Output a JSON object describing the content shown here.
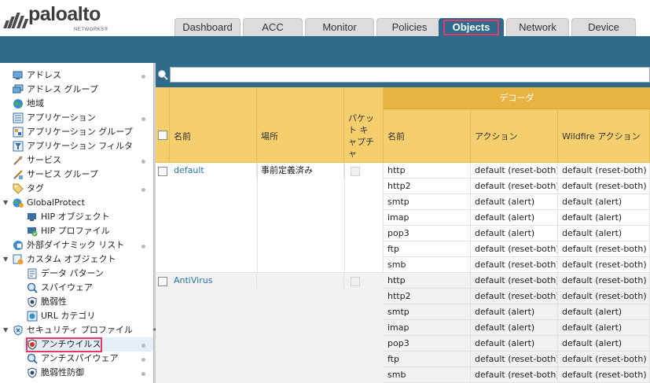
{
  "brand": {
    "name": "paloalto",
    "sub": "NETWORKS®"
  },
  "tabs": [
    {
      "label": "Dashboard"
    },
    {
      "label": "ACC"
    },
    {
      "label": "Monitor"
    },
    {
      "label": "Policies"
    },
    {
      "label": "Objects",
      "active": true
    },
    {
      "label": "Network"
    },
    {
      "label": "Device"
    }
  ],
  "sidebar": {
    "items": [
      {
        "label": "アドレス",
        "icon": "address-icon"
      },
      {
        "label": "アドレス グループ",
        "icon": "address-group-icon"
      },
      {
        "label": "地域",
        "icon": "globe-icon"
      },
      {
        "label": "アプリケーション",
        "icon": "application-icon"
      },
      {
        "label": "アプリケーション グループ",
        "icon": "application-group-icon"
      },
      {
        "label": "アプリケーション フィルタ",
        "icon": "application-filter-icon"
      },
      {
        "label": "サービス",
        "icon": "service-icon"
      },
      {
        "label": "サービス グループ",
        "icon": "service-group-icon"
      },
      {
        "label": "タグ",
        "icon": "tag-icon"
      },
      {
        "label": "GlobalProtect",
        "icon": "globalprotect-icon"
      },
      {
        "label": "HIP オブジェクト",
        "icon": "hip-object-icon"
      },
      {
        "label": "HIP プロファイル",
        "icon": "hip-profile-icon"
      },
      {
        "label": "外部ダイナミック リスト",
        "icon": "external-list-icon"
      },
      {
        "label": "カスタム オブジェクト",
        "icon": "custom-object-icon"
      },
      {
        "label": "データ パターン",
        "icon": "data-pattern-icon"
      },
      {
        "label": "スパイウェア",
        "icon": "spyware-icon"
      },
      {
        "label": "脆弱性",
        "icon": "vulnerability-icon"
      },
      {
        "label": "URL カテゴリ",
        "icon": "url-category-icon"
      },
      {
        "label": "セキュリティ プロファイル",
        "icon": "security-profile-icon"
      },
      {
        "label": "アンチウイルス",
        "icon": "antivirus-icon"
      },
      {
        "label": "アンチスパイウェア",
        "icon": "anti-spyware-icon"
      },
      {
        "label": "脆弱性防御",
        "icon": "vulnerability-protection-icon"
      }
    ]
  },
  "search": {
    "value": "",
    "placeholder": ""
  },
  "table": {
    "headers": {
      "name": "名前",
      "location": "場所",
      "pcap": "パケット キャプチャ",
      "group": "デコーダ",
      "decoder_name": "名前",
      "action": "アクション",
      "wildfire": "Wildfire アクション"
    },
    "profiles": [
      {
        "name": "default",
        "location": "事前定義済み",
        "rows": [
          {
            "decoder": "http",
            "action": "default (reset-both)",
            "wildfire": "default (reset-both)"
          },
          {
            "decoder": "http2",
            "action": "default (reset-both)",
            "wildfire": "default (reset-both)"
          },
          {
            "decoder": "smtp",
            "action": "default (alert)",
            "wildfire": "default (alert)"
          },
          {
            "decoder": "imap",
            "action": "default (alert)",
            "wildfire": "default (alert)"
          },
          {
            "decoder": "pop3",
            "action": "default (alert)",
            "wildfire": "default (alert)"
          },
          {
            "decoder": "ftp",
            "action": "default (reset-both)",
            "wildfire": "default (reset-both)"
          },
          {
            "decoder": "smb",
            "action": "default (reset-both)",
            "wildfire": "default (reset-both)"
          }
        ]
      },
      {
        "name": "AntiVirus",
        "location": "",
        "rows": [
          {
            "decoder": "http",
            "action": "default (reset-both)",
            "wildfire": "default (reset-both)"
          },
          {
            "decoder": "http2",
            "action": "default (reset-both)",
            "wildfire": "default (reset-both)"
          },
          {
            "decoder": "smtp",
            "action": "default (alert)",
            "wildfire": "default (alert)"
          },
          {
            "decoder": "imap",
            "action": "default (alert)",
            "wildfire": "default (alert)"
          },
          {
            "decoder": "pop3",
            "action": "default (alert)",
            "wildfire": "default (alert)"
          },
          {
            "decoder": "ftp",
            "action": "default (reset-both)",
            "wildfire": "default (reset-both)"
          },
          {
            "decoder": "smb",
            "action": "default (reset-both)",
            "wildfire": "default (reset-both)"
          }
        ]
      }
    ]
  },
  "colors": {
    "banner": "#2e6a8a",
    "header_row": "#f5cf6d",
    "group_header": "#e9b342",
    "highlight": "#e5386f",
    "link": "#2a73a6"
  }
}
